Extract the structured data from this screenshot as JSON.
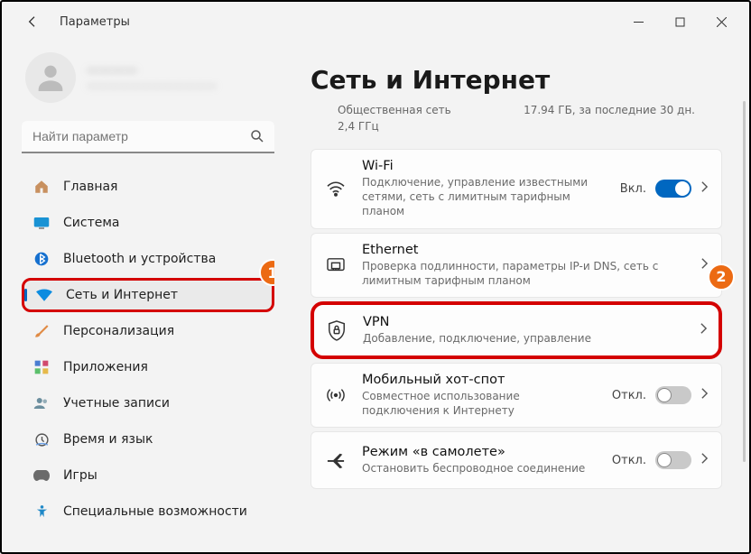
{
  "window": {
    "title": "Параметры"
  },
  "account": {
    "name": "————",
    "email": "————————————"
  },
  "search": {
    "placeholder": "Найти параметр"
  },
  "sidebar": {
    "items": [
      {
        "label": "Главная"
      },
      {
        "label": "Система"
      },
      {
        "label": "Bluetooth и устройства"
      },
      {
        "label": "Сеть и Интернет"
      },
      {
        "label": "Персонализация"
      },
      {
        "label": "Приложения"
      },
      {
        "label": "Учетные записи"
      },
      {
        "label": "Время и язык"
      },
      {
        "label": "Игры"
      },
      {
        "label": "Специальные возможности"
      }
    ]
  },
  "page": {
    "title": "Сеть и Интернет",
    "statusLeftTop": "Общественная сеть",
    "statusLeftBottom": "2,4 ГГц",
    "statusRight": "17.94 ГБ, за последние 30 дн."
  },
  "cards": {
    "wifi": {
      "title": "Wi-Fi",
      "sub": "Подключение, управление известными сетями, сеть с лимитным тарифным планом",
      "state": "Вкл."
    },
    "ethernet": {
      "title": "Ethernet",
      "sub": "Проверка подлинности, параметры IP-и DNS, сеть с лимитным тарифным планом"
    },
    "vpn": {
      "title": "VPN",
      "sub": "Добавление, подключение, управление"
    },
    "hotspot": {
      "title": "Мобильный хот-спот",
      "sub": "Совместное использование подключения к Интернету",
      "state": "Откл."
    },
    "airplane": {
      "title": "Режим «в самолете»",
      "sub": "Остановить беспроводное соединение",
      "state": "Откл."
    }
  },
  "badges": {
    "one": "1",
    "two": "2"
  }
}
